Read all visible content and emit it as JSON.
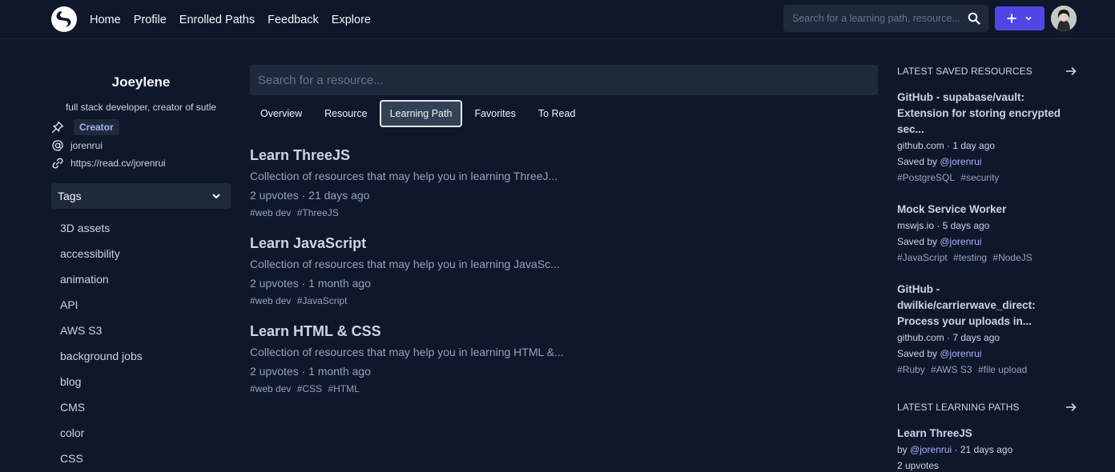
{
  "nav": {
    "links": [
      "Home",
      "Profile",
      "Enrolled Paths",
      "Feedback",
      "Explore"
    ],
    "search_placeholder": "Search for a learning path, resource...",
    "accent": "#4f46e5"
  },
  "profile": {
    "name": "Joeylene",
    "bio": "full stack developer, creator of sutle",
    "role_badge": "Creator",
    "handle": "jorenrui",
    "website": "https://read.cv/jorenrui"
  },
  "tags_panel": {
    "title": "Tags",
    "items": [
      "3D assets",
      "accessibility",
      "animation",
      "API",
      "AWS S3",
      "background jobs",
      "blog",
      "CMS",
      "color",
      "CSS"
    ]
  },
  "main": {
    "search_placeholder": "Search for a resource...",
    "tabs": [
      "Overview",
      "Resource",
      "Learning Path",
      "Favorites",
      "To Read"
    ],
    "active_tab": "Learning Path",
    "paths": [
      {
        "title": "Learn ThreeJS",
        "description": "Collection of resources that may help you in learning ThreeJ...",
        "meta": "2 upvotes · 21 days ago",
        "tags": [
          "#web dev",
          "#ThreeJS"
        ]
      },
      {
        "title": "Learn JavaScript",
        "description": "Collection of resources that may help you in learning JavaSc...",
        "meta": "2 upvotes · 1 month ago",
        "tags": [
          "#web dev",
          "#JavaScript"
        ]
      },
      {
        "title": "Learn HTML & CSS",
        "description": "Collection of resources that may help you in learning HTML &...",
        "meta": "2 upvotes · 1 month ago",
        "tags": [
          "#web dev",
          "#CSS",
          "#HTML"
        ]
      }
    ]
  },
  "saved": {
    "heading": "LATEST SAVED RESOURCES",
    "items": [
      {
        "title_lines": [
          "GitHub - supabase/vault:",
          "Extension for storing encrypted",
          "sec..."
        ],
        "source": "github.com · 1 day ago",
        "saved_prefix": "Saved by ",
        "saved_by": "@jorenrui",
        "tags": [
          "#PostgreSQL",
          "#security"
        ]
      },
      {
        "title_lines": [
          "Mock Service Worker"
        ],
        "source": "mswjs.io · 5 days ago",
        "saved_prefix": "Saved by ",
        "saved_by": "@jorenrui",
        "tags": [
          "#JavaScript",
          "#testing",
          "#NodeJS"
        ]
      },
      {
        "title_lines": [
          "GitHub -",
          "dwilkie/carrierwave_direct:",
          "Process your uploads in..."
        ],
        "source": "github.com · 7 days ago",
        "saved_prefix": "Saved by ",
        "saved_by": "@jorenrui",
        "tags": [
          "#Ruby",
          "#AWS S3",
          "#file upload"
        ]
      }
    ]
  },
  "latest_paths": {
    "heading": "LATEST LEARNING PATHS",
    "items": [
      {
        "title": "Learn ThreeJS",
        "by_prefix": "by ",
        "author": "@jorenrui",
        "time": " · 21 days ago",
        "upvotes": "2 upvotes"
      }
    ]
  }
}
